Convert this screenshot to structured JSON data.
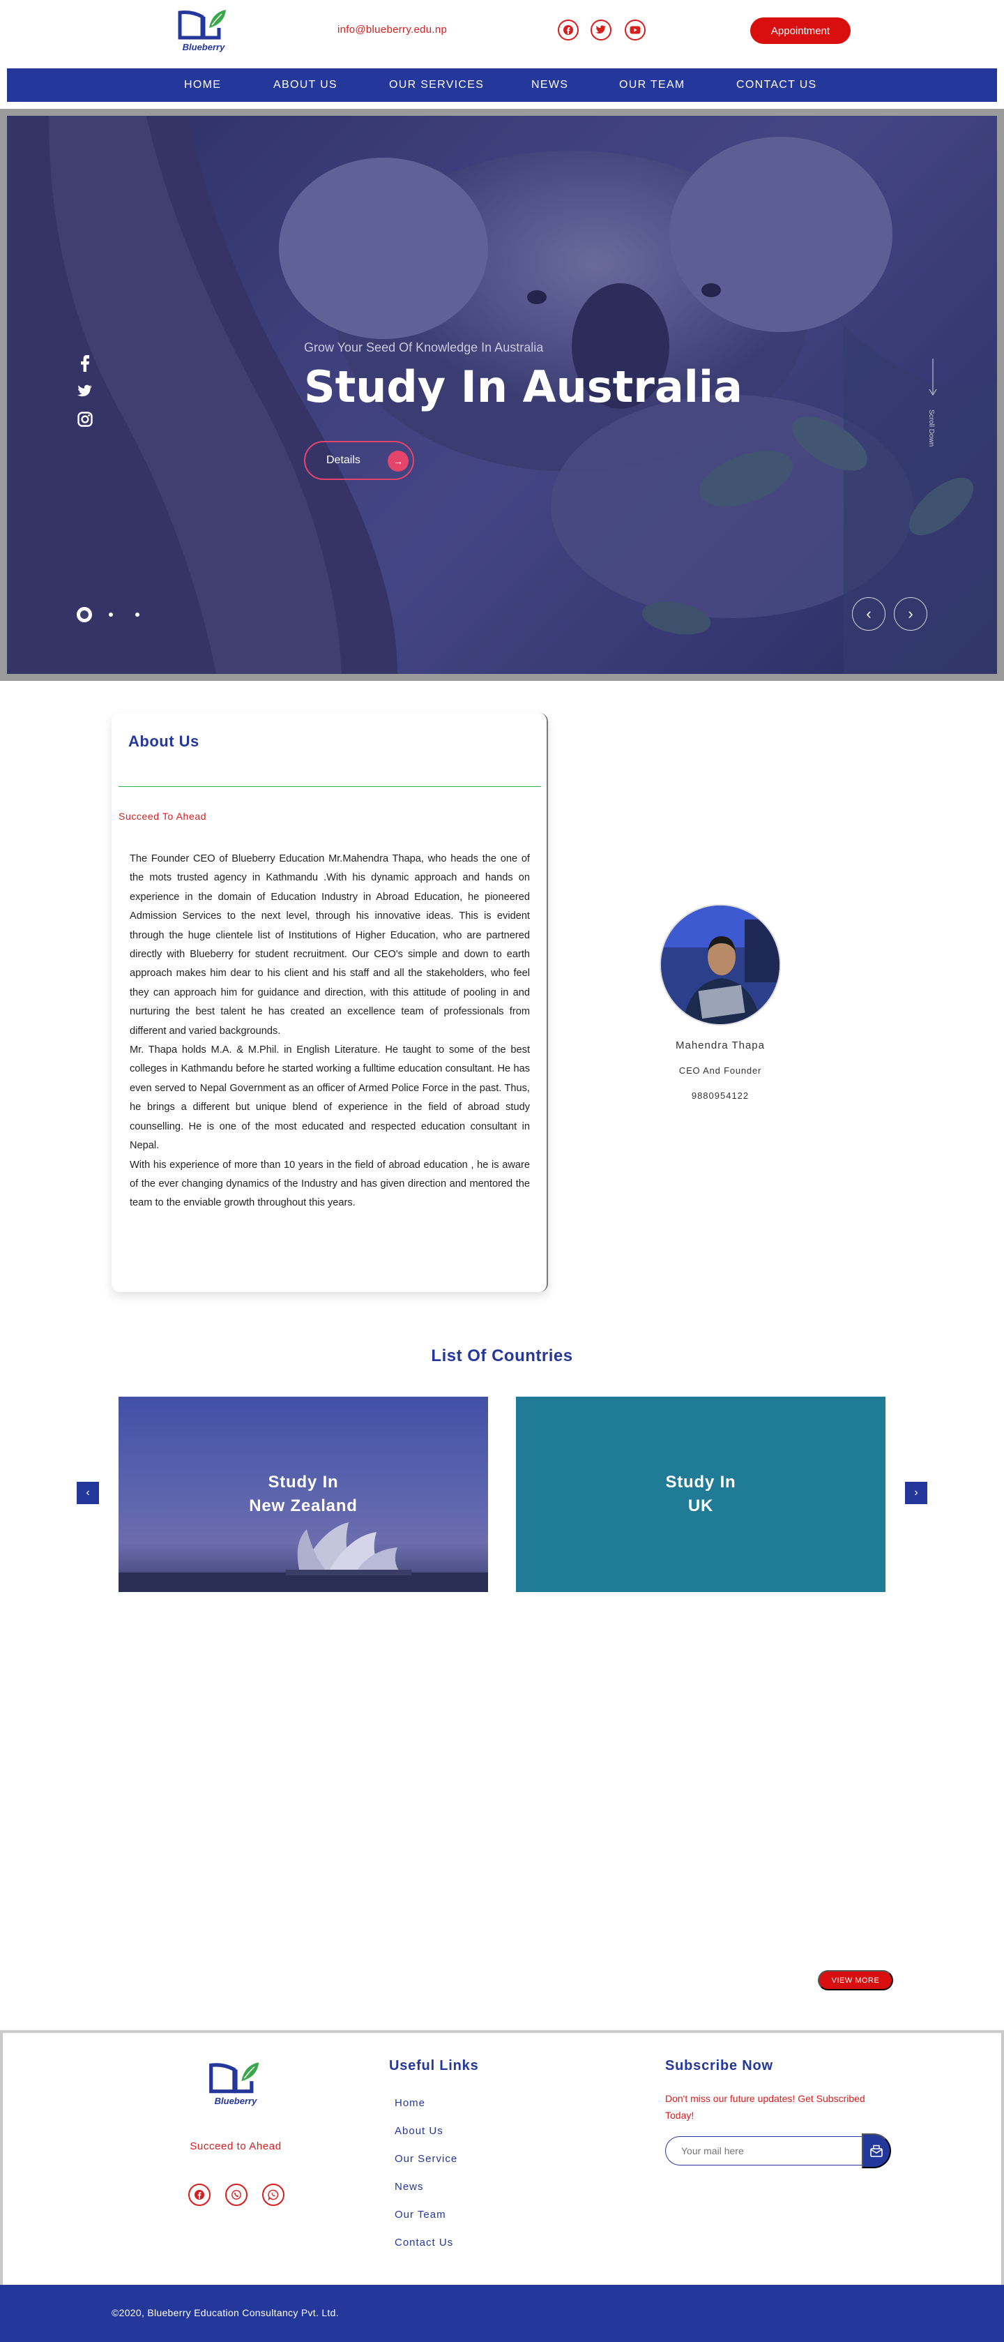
{
  "header": {
    "logo_text": "Blueberry",
    "email": "info@blueberry.edu.np",
    "social_icons": [
      "facebook-icon",
      "twitter-icon",
      "youtube-icon"
    ],
    "appointment_label": "Appointment"
  },
  "nav": {
    "items": [
      "HOME",
      "ABOUT US",
      "OUR SERVICES",
      "NEWS",
      "OUR TEAM",
      "CONTACT US"
    ]
  },
  "hero": {
    "subtitle": "Grow Your Seed Of Knowledge In Australia",
    "title": "Study In Australia",
    "details_label": "Details",
    "scroll_label": "Scroll Down",
    "social_icons": [
      "facebook-icon",
      "twitter-icon",
      "instagram-icon"
    ],
    "slide_count": 3,
    "active_slide": 1
  },
  "about": {
    "title": "About Us",
    "subtitle": "Succeed To Ahead",
    "paragraphs": [
      "The Founder CEO of Blueberry Education Mr.Mahendra Thapa, who heads the one of the mots trusted  agency in Kathmandu .With his dynamic approach and hands on experience in the domain of Education Industry in Abroad Education, he pioneered Admission Services to the next level, through his innovative ideas. This is evident through the huge clientele list of Institutions of Higher Education, who are partnered directly with Blueberry for student recruitment. Our CEO's simple and down to earth approach makes him dear to his client and his staff and all the stakeholders, who feel they can approach him for guidance and direction, with this attitude of pooling in and nurturing the best talent he has created an excellence team of professionals from different and varied backgrounds.",
      "Mr. Thapa holds M.A. & M.Phil. in English Literature. He  taught to some of the best colleges in Kathmandu before he started working a fulltime education consultant. He  has even served to Nepal Government as an officer of Armed Police Force in the past. Thus, he brings a different but unique blend of experience in the field of abroad study counselling. He is one of the most educated and respected education consultant in Nepal.",
      "With his experience of more than 10 years in the field of abroad education , he is aware of the ever changing dynamics of the Industry and has given direction and mentored the team to the enviable growth throughout this years."
    ],
    "ceo": {
      "name": "Mahendra Thapa",
      "role": "CEO And Founder",
      "phone": "9880954122"
    }
  },
  "countries": {
    "title": "List Of Countries",
    "cards": [
      {
        "line1": "Study In",
        "line2": "New Zealand",
        "color": "#4a55a8"
      },
      {
        "line1": "Study In",
        "line2": "UK",
        "color": "#207b97"
      }
    ],
    "view_more_label": "VIEW MORE"
  },
  "footer": {
    "logo_text": "Blueberry",
    "tagline": "Succeed to Ahead",
    "social_icons": [
      "facebook-icon",
      "viber-icon",
      "whatsapp-icon"
    ],
    "links_title": "Useful Links",
    "links": [
      "Home",
      "About Us",
      "Our Service",
      "News",
      "Our Team",
      "Contact Us"
    ],
    "subscribe_title": "Subscribe Now",
    "subscribe_text": "Don't miss our future updates! Get Subscribed Today!",
    "mail_placeholder": "Your mail here",
    "copyright": "©2020, Blueberry Education Consultancy Pvt. Ltd."
  },
  "colors": {
    "brand_blue": "#24379a",
    "accent_red": "#d90f0f",
    "hero_pink": "#e6456b",
    "green": "#2bb34b"
  }
}
